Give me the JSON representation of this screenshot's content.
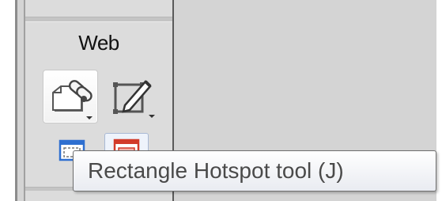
{
  "panel": {
    "title": "Web",
    "tools": [
      {
        "icon": "slice-tool-icon",
        "has_dropdown": true
      },
      {
        "icon": "slice-select-tool-icon",
        "has_dropdown": true
      },
      {
        "icon": "rectangle-hotspot-tool-icon",
        "has_dropdown": false
      },
      {
        "icon": "hotspot-tool-icon",
        "has_dropdown": false
      }
    ]
  },
  "tooltip": {
    "text": "Rectangle Hotspot tool (J)"
  },
  "colors": {
    "panel_bg": "#dcdcdc",
    "workspace_bg": "#d4d4d4",
    "hotspot_blue": "#2e6fd0",
    "hotspot_red": "#d23a2a"
  }
}
